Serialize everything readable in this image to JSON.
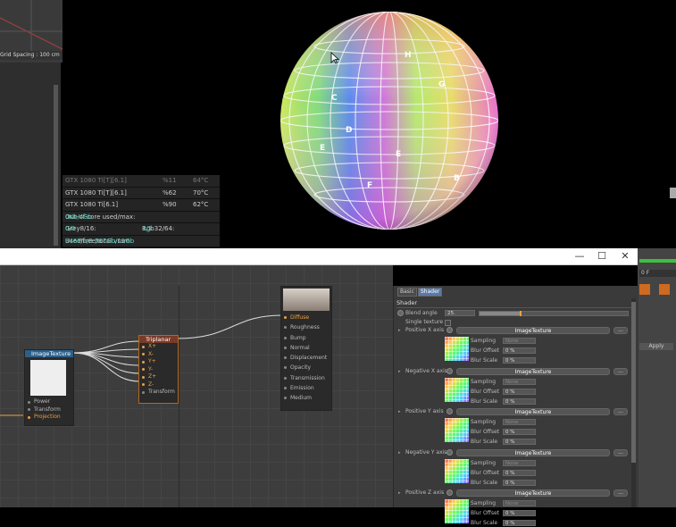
{
  "viewport": {
    "grid_spacing": "Grid Spacing : 100 cm"
  },
  "render_stats": {
    "gpus": [
      {
        "name": "GTX 1080 Ti[T][6.1]",
        "load": "%11",
        "temp": "64°C"
      },
      {
        "name": "GTX 1080 Ti[T][6.1]",
        "load": "%62",
        "temp": "70°C"
      },
      {
        "name": "GTX 1080 Ti[6.1]",
        "load": "%90",
        "temp": "62°C"
      }
    ],
    "out_of_core_label": "Out-of-core used/max:",
    "out_of_core_value": "0Kb/4Gb",
    "grey_label": "Grey8/16:",
    "grey_value": "0/0",
    "rgb_label": "Rgb32/64:",
    "rgb_value": "1/1",
    "vram_label": "Used/free/total vram:",
    "vram_value": "346Mb/8.567Gb/11Gb"
  },
  "sphere_letters": [
    "A",
    "B",
    "C",
    "D",
    "E",
    "F",
    "G",
    "H"
  ],
  "window": {
    "minimize": "—",
    "maximize": "☐",
    "close": "✕"
  },
  "right_panel": {
    "frame_field": "0 F",
    "apply": "Apply"
  },
  "nodes": {
    "image_texture": {
      "title": "ImageTexture",
      "ports": [
        "Power",
        "Transform",
        "Projection"
      ]
    },
    "triplanar": {
      "title": "Triplanar",
      "ports": [
        "X+",
        "X-",
        "Y+",
        "Y-",
        "Z+",
        "Z-",
        "Transform"
      ]
    },
    "material": {
      "ports": [
        "Diffuse",
        "Roughness",
        "Bump",
        "Normal",
        "Displacement",
        "Opacity",
        "Transmission",
        "Emission",
        "Medium"
      ]
    }
  },
  "attributes": {
    "tabs": [
      "Basic",
      "Shader"
    ],
    "section": "Shader",
    "blend_angle_label": "Blend angle",
    "blend_angle_value": "25.",
    "blend_angle_fraction": 0.27,
    "single_texture_label": "Single texture",
    "axes": [
      {
        "label": "Positive X axis",
        "texture": "ImageTexture"
      },
      {
        "label": "Negative X axis",
        "texture": "ImageTexture"
      },
      {
        "label": "Positive Y axis",
        "texture": "ImageTexture"
      },
      {
        "label": "Negative Y axis",
        "texture": "ImageTexture"
      },
      {
        "label": "Positive Z axis",
        "texture": "ImageTexture"
      }
    ],
    "sampling_label": "Sampling",
    "sampling_value": "None",
    "blur_offset_label": "Blur Offset",
    "blur_offset_value": "0 %",
    "blur_scale_label": "Blur Scale",
    "blur_scale_value": "0 %",
    "more_button": "..."
  },
  "colors": {
    "accent": "#5fd1c0",
    "orange": "#f0a040",
    "selected_tab": "#5a7aa8"
  }
}
